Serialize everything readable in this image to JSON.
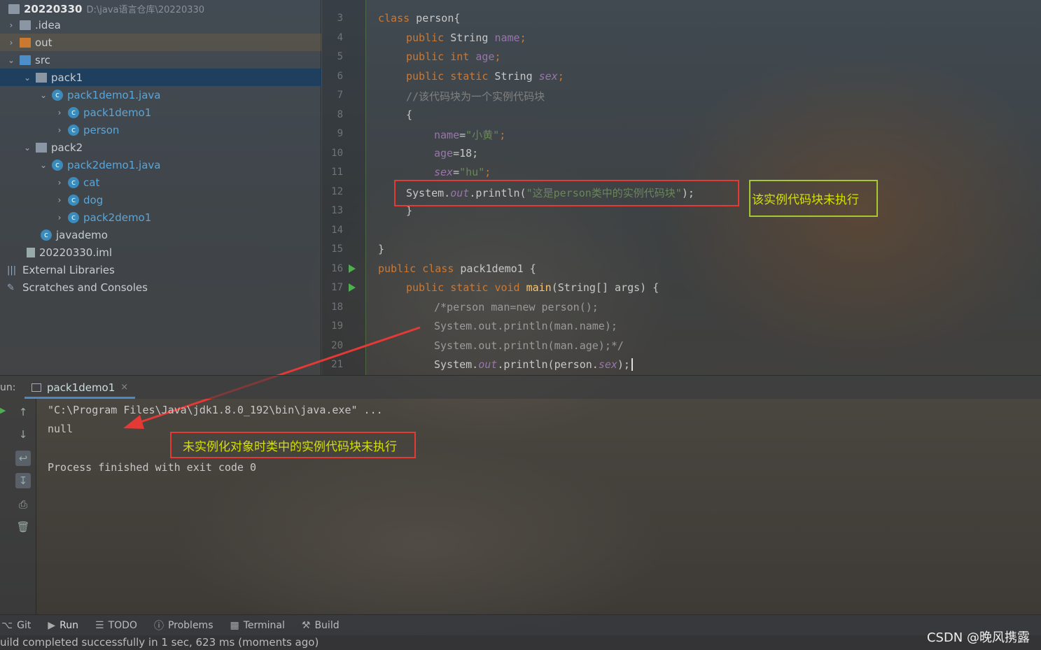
{
  "project": {
    "root_name": "20220330",
    "root_path": "D:\\java语言仓库\\20220330",
    "items": [
      {
        "label": ".idea"
      },
      {
        "label": "out"
      },
      {
        "label": "src"
      },
      {
        "label": "pack1"
      },
      {
        "label": "pack1demo1.java"
      },
      {
        "label": "pack1demo1"
      },
      {
        "label": "person"
      },
      {
        "label": "pack2"
      },
      {
        "label": "pack2demo1.java"
      },
      {
        "label": "cat"
      },
      {
        "label": "dog"
      },
      {
        "label": "pack2demo1"
      },
      {
        "label": "javademo"
      },
      {
        "label": "20220330.iml"
      },
      {
        "label": "External Libraries"
      },
      {
        "label": "Scratches and Consoles"
      }
    ]
  },
  "editor": {
    "line_numbers": [
      "3",
      "4",
      "5",
      "6",
      "7",
      "8",
      "9",
      "10",
      "11",
      "12",
      "13",
      "14",
      "15",
      "16",
      "17",
      "18",
      "19",
      "20",
      "21"
    ],
    "code": {
      "l3a": "class",
      "l3b": " person{",
      "l4a": "public",
      "l4b": " String ",
      "l4c": "name",
      "l4d": ";",
      "l5a": "public",
      "l5b": " ",
      "l5c": "int",
      "l5d": " ",
      "l5e": "age",
      "l5f": ";",
      "l6a": "public",
      "l6b": " ",
      "l6c": "static",
      "l6d": " String ",
      "l6e": "sex",
      "l6f": ";",
      "l7": "//该代码块为一个实例代码块",
      "l8": "{",
      "l9a": "name",
      "l9b": "=",
      "l9c": "\"小黄\"",
      "l9d": ";",
      "l10a": "age",
      "l10b": "=18;",
      "l11a": "sex",
      "l11b": "=",
      "l11c": "\"hu\"",
      "l11d": ";",
      "l12a": "System.",
      "l12b": "out",
      "l12c": ".println(",
      "l12d": "\"这是person类中的实例代码块\"",
      "l12e": ");",
      "l13": "}",
      "l15": "}",
      "l16a": "public",
      "l16b": " ",
      "l16c": "class",
      "l16d": " pack1demo1 {",
      "l17a": "public",
      "l17b": " ",
      "l17c": "static",
      "l17d": " ",
      "l17e": "void",
      "l17f": " ",
      "l17g": "main",
      "l17h": "(String[] args) {",
      "l18": "/*person man=new person();",
      "l19": "System.out.println(man.name);",
      "l20": "System.out.println(man.age);*/",
      "l21a": "System.",
      "l21b": "out",
      "l21c": ".println(person.",
      "l21d": "sex",
      "l21e": ");"
    }
  },
  "annotations": {
    "box1_note": "该实例代码块未执行",
    "box2_note": "未实例化对象时类中的实例代码块未执行",
    "colors": {
      "red": "#e53935",
      "yellowgreen": "#a6c832",
      "note_text": "#d4e000"
    }
  },
  "run": {
    "label": "un:",
    "tab": "pack1demo1",
    "console": [
      "\"C:\\Program Files\\Java\\jdk1.8.0_192\\bin\\java.exe\" ...",
      "null",
      "",
      "Process finished with exit code 0"
    ]
  },
  "bottom_tabs": [
    "Git",
    "Run",
    "TODO",
    "Problems",
    "Terminal",
    "Build"
  ],
  "status": "uild completed successfully in 1 sec, 623 ms (moments ago)",
  "watermark": "CSDN @晚风携露"
}
